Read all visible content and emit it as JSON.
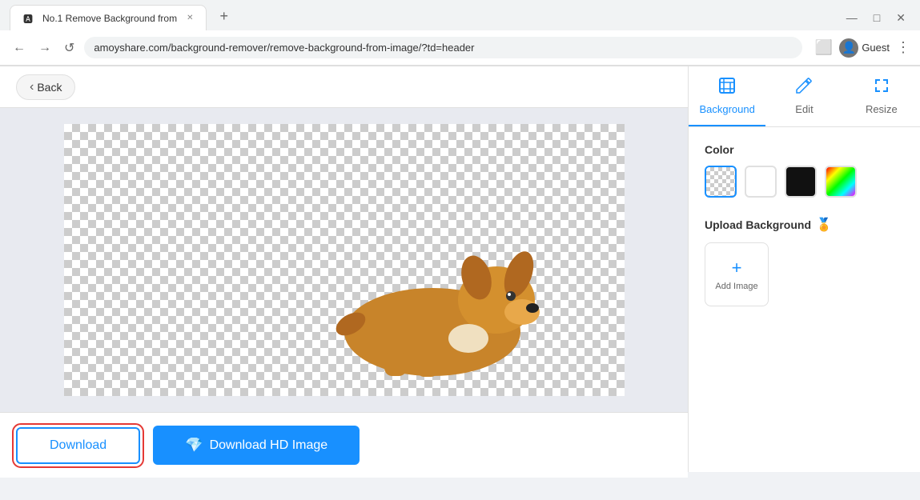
{
  "browser": {
    "tab_title": "No.1 Remove Background from",
    "tab_favicon": "🅰",
    "new_tab_label": "+",
    "address": "amoyshare.com/background-remover/remove-background-from-image/?td=header",
    "back_btn": "←",
    "forward_btn": "→",
    "refresh_btn": "↺",
    "profile_label": "Guest",
    "window_controls": {
      "minimize": "—",
      "maximize": "□",
      "close": "✕"
    }
  },
  "toolbar": {
    "back_label": "Back",
    "back_arrow": "‹"
  },
  "panel": {
    "background_tab_label": "Background",
    "edit_tab_label": "Edit",
    "resize_tab_label": "Resize",
    "color_section_label": "Color",
    "upload_bg_label": "Upload Background",
    "add_image_label": "Add Image",
    "premium_icon": "🏅"
  },
  "actions": {
    "download_label": "Download",
    "download_hd_label": "Download HD Image",
    "diamond_icon": "💎"
  },
  "swatches": [
    {
      "type": "transparent",
      "label": "Transparent",
      "selected": true
    },
    {
      "type": "white",
      "label": "White"
    },
    {
      "type": "black",
      "label": "Black"
    },
    {
      "type": "color",
      "label": "Color"
    }
  ]
}
